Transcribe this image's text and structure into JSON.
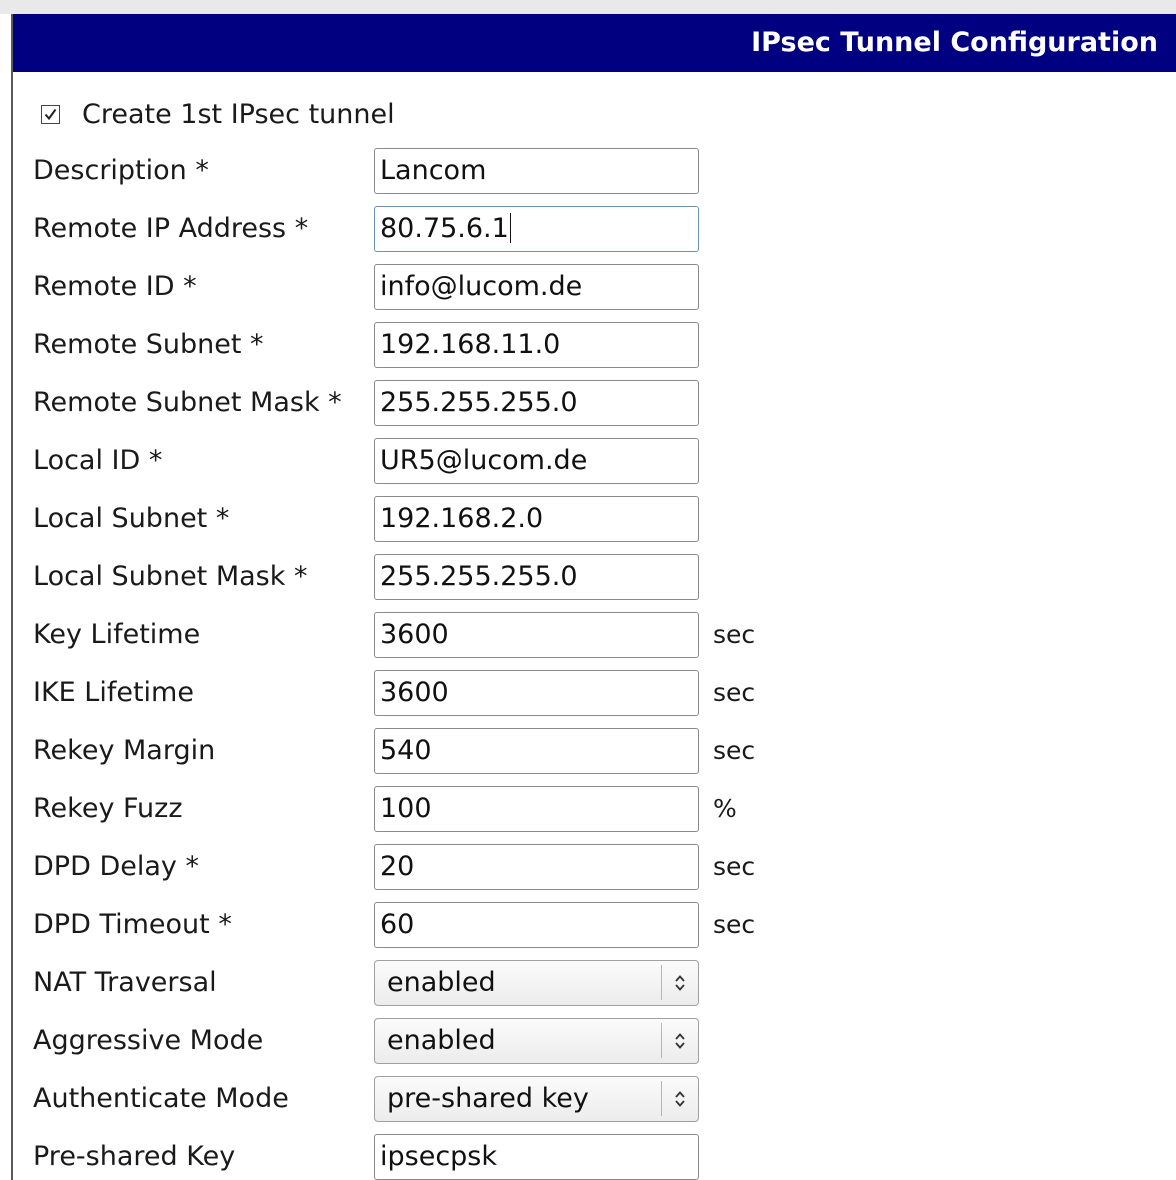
{
  "header": {
    "title": "IPsec Tunnel Configuration"
  },
  "create_tunnel": {
    "label": "Create 1st IPsec tunnel",
    "checked": true
  },
  "fields": {
    "description": {
      "label": "Description *",
      "value": "Lancom"
    },
    "remote_ip": {
      "label": "Remote IP Address *",
      "value": "80.75.6.1"
    },
    "remote_id": {
      "label": "Remote ID *",
      "value": "info@lucom.de"
    },
    "remote_subnet": {
      "label": "Remote Subnet *",
      "value": "192.168.11.0"
    },
    "remote_subnet_mask": {
      "label": "Remote Subnet Mask *",
      "value": "255.255.255.0"
    },
    "local_id": {
      "label": "Local ID *",
      "value": "UR5@lucom.de"
    },
    "local_subnet": {
      "label": "Local Subnet *",
      "value": "192.168.2.0"
    },
    "local_subnet_mask": {
      "label": "Local Subnet Mask *",
      "value": "255.255.255.0"
    },
    "key_lifetime": {
      "label": "Key Lifetime",
      "value": "3600",
      "unit": "sec"
    },
    "ike_lifetime": {
      "label": "IKE Lifetime",
      "value": "3600",
      "unit": "sec"
    },
    "rekey_margin": {
      "label": "Rekey Margin",
      "value": "540",
      "unit": "sec"
    },
    "rekey_fuzz": {
      "label": "Rekey Fuzz",
      "value": "100",
      "unit": "%"
    },
    "dpd_delay": {
      "label": "DPD Delay *",
      "value": "20",
      "unit": "sec"
    },
    "dpd_timeout": {
      "label": "DPD Timeout *",
      "value": "60",
      "unit": "sec"
    },
    "nat_traversal": {
      "label": "NAT Traversal",
      "selected": "enabled"
    },
    "aggressive_mode": {
      "label": "Aggressive Mode",
      "selected": "enabled"
    },
    "authenticate_mode": {
      "label": "Authenticate Mode",
      "selected": "pre-shared key"
    },
    "pre_shared_key": {
      "label": "Pre-shared Key",
      "value": "ipsecpsk"
    }
  },
  "colors": {
    "title_bar": "#000080",
    "title_text": "#ffffff"
  }
}
